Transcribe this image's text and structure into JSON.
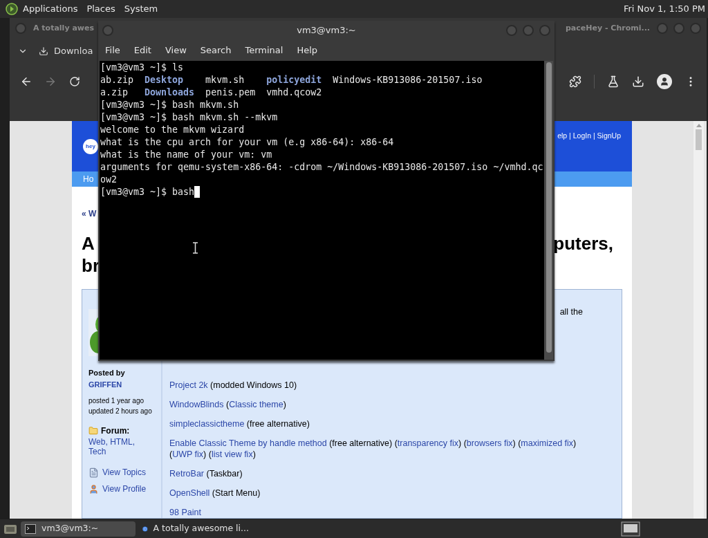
{
  "top_panel": {
    "menus": [
      "Applications",
      "Places",
      "System"
    ],
    "clock": "Fri Nov 1, 1:50 PM"
  },
  "browser": {
    "title_left": "A totally awes",
    "title_right": "paceHey - Chromi...",
    "download_label": "Downloa",
    "page": {
      "logo": "hey",
      "header_links": "elp | LogIn | SignUp",
      "nav": "Ho",
      "back_link": "« W",
      "heading_left": [
        "A",
        "br"
      ],
      "heading_right": "puters,",
      "intro_fragment": "all the",
      "sidebar": {
        "posted_by": "Posted by",
        "author": "GRIFFEN",
        "posted": "posted 1 year ago",
        "updated": "updated 2 hours ago",
        "forum_label": "Forum:",
        "forums": "Web, HTML, Tech",
        "actions": [
          "View Topics",
          "View Profile"
        ]
      },
      "items": [
        [
          {
            "text": "Project 2k",
            "link": true
          },
          {
            "text": " (modded Windows 10)",
            "link": false
          }
        ],
        [
          {
            "text": "WindowBlinds",
            "link": true
          },
          {
            "text": " (",
            "link": false
          },
          {
            "text": "Classic theme",
            "link": true
          },
          {
            "text": ")",
            "link": false
          }
        ],
        [
          {
            "text": "simpleclassictheme",
            "link": true
          },
          {
            "text": " (free alternative)",
            "link": false
          }
        ],
        [
          {
            "text": "Enable Classic Theme by handle method",
            "link": true
          },
          {
            "text": " (free alternative) (",
            "link": false
          },
          {
            "text": "transparency fix",
            "link": true
          },
          {
            "text": ") (",
            "link": false
          },
          {
            "text": "browsers fix",
            "link": true
          },
          {
            "text": ") (",
            "link": false
          },
          {
            "text": "maximized fix",
            "link": true
          },
          {
            "text": ") (",
            "link": false
          },
          {
            "text": "UWP fix",
            "link": true
          },
          {
            "text": ") (",
            "link": false
          },
          {
            "text": "list view fix",
            "link": true
          },
          {
            "text": ")",
            "link": false
          }
        ],
        [
          {
            "text": "RetroBar",
            "link": true
          },
          {
            "text": " (Taskbar)",
            "link": false
          }
        ],
        [
          {
            "text": "OpenShell",
            "link": true
          },
          {
            "text": " (Start Menu)",
            "link": false
          }
        ],
        [
          {
            "text": "98 Paint",
            "link": true
          }
        ]
      ]
    }
  },
  "terminal": {
    "title": "vm3@vm3:~",
    "menus": [
      "File",
      "Edit",
      "View",
      "Search",
      "Terminal",
      "Help"
    ],
    "lines": [
      [
        {
          "text": "[vm3@vm3 ~]$ ls",
          "kind": "plain"
        }
      ],
      [
        {
          "text": "ab.zip  ",
          "kind": "plain"
        },
        {
          "text": "Desktop",
          "kind": "dir"
        },
        {
          "text": "    mkvm.sh    ",
          "kind": "plain"
        },
        {
          "text": "policyedit",
          "kind": "dir"
        },
        {
          "text": "  Windows-KB913086-201507.iso",
          "kind": "plain"
        }
      ],
      [
        {
          "text": "a.zip   ",
          "kind": "plain"
        },
        {
          "text": "Downloads",
          "kind": "dir"
        },
        {
          "text": "  penis.pem  vmhd.qcow2",
          "kind": "plain"
        }
      ],
      [
        {
          "text": "[vm3@vm3 ~]$ bash mkvm.sh",
          "kind": "plain"
        }
      ],
      [
        {
          "text": "[vm3@vm3 ~]$ bash mkvm.sh --mkvm",
          "kind": "plain"
        }
      ],
      [
        {
          "text": "welcome to the mkvm wizard",
          "kind": "plain"
        }
      ],
      [
        {
          "text": "what is the cpu arch for your vm (e.g x86-64): x86-64",
          "kind": "plain"
        }
      ],
      [
        {
          "text": "what is the name of your vm: vm",
          "kind": "plain"
        }
      ],
      [
        {
          "text": "arguments for qemu-system-x86-64: -cdrom ~/Windows-KB913086-201507.iso ~/vmhd.qc",
          "kind": "plain"
        }
      ],
      [
        {
          "text": "ow2",
          "kind": "plain"
        }
      ],
      [
        {
          "text": "[vm3@vm3 ~]$ bash",
          "kind": "plain"
        }
      ]
    ]
  },
  "taskbar": {
    "items": [
      {
        "label": "vm3@vm3:~",
        "kind": "terminal",
        "selected": true
      },
      {
        "label": "A totally awesome li...",
        "kind": "browser",
        "selected": false
      }
    ]
  }
}
